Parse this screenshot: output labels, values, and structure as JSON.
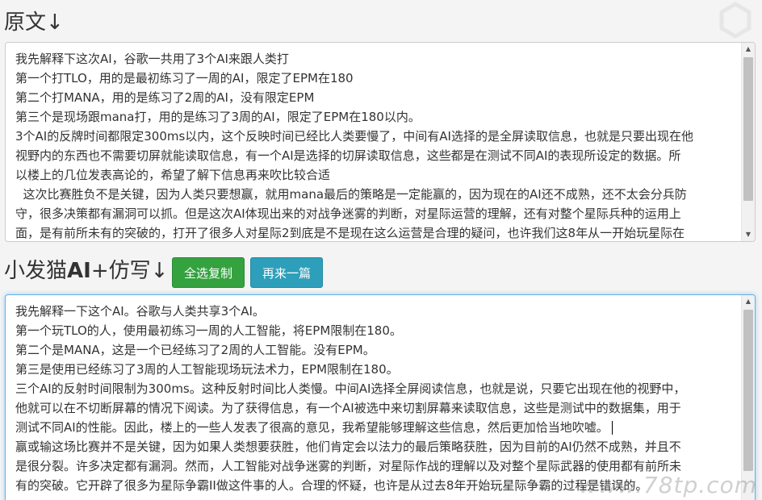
{
  "original": {
    "title": "原文↓",
    "lines": [
      "我先解释下这次AI，谷歌一共用了3个AI来跟人类打",
      "第一个打TLO，用的是最初练习了一周的AI，限定了EPM在180",
      "第二个打MANA，用的是练习了2周的AI，没有限定EPM",
      "第三个是现场跟mana打，用的是练习了3周的AI，限定了EPM在180以内。",
      "3个AI的反牌时间都限定300ms以内，这个反映时间已经比人类要慢了，中间有AI选择的是全屏读取信息，也就是只要出现在他",
      "视野内的东西也不需要切屏就能读取信息，有一个AI是选择的切屏读取信息，这些都是在测试不同AI的表现所设定的数据。所",
      "以楼上的几位发表高论的，希望了解下信息再来吹比较合适",
      "  这次比赛胜负不是关键，因为人类只要想赢，就用mana最后的策略是一定能赢的，因为现在的AI还不成熟，还不太会分兵防",
      "守，很多决策都有漏洞可以抓。但是这次AI体现出来的对战争迷雾的判断，对星际运营的理解，还有对整个星际兵种的运用上",
      "面，是有前所未有的突破的，打开了很多人对星际2到底是不是现在这么运营是合理的疑问，也许我们这8年从一开始玩星际在"
    ]
  },
  "rewrite": {
    "title_prefix": "小发猫",
    "title_ai": "AI",
    "title_suffix": "+仿写↓",
    "copy_button": "全选复制",
    "again_button": "再来一篇",
    "lines": [
      "我先解释一下这个AI。谷歌与人类共享3个AI。",
      "第一个玩TLO的人，使用最初练习一周的人工智能，将EPM限制在180。",
      "第二个是MANA，这是一个已经练习了2周的人工智能。没有EPM。",
      "第三是使用已经练习了3周的人工智能现场玩法术力，EPM限制在180。",
      "三个AI的反射时间限制为300ms。这种反射时间比人类慢。中间AI选择全屏阅读信息，也就是说，只要它出现在他的视野中，",
      "他就可以在不切断屏幕的情况下阅读。为了获得信息，有一个AI被选中来切割屏幕来读取信息，这些是测试中的数据集，用于",
      "测试不同AI的性能。因此，楼上的一些人发表了很高的意见，我希望能够理解这些信息，然后更加恰当地吹嘘。",
      "赢或输这场比赛并不是关键，因为如果人类想要获胜，他们肯定会以法力的最后策略获胜，因为目前的AI仍然不成熟，并且不",
      "是很分裂。许多决定都有漏洞。然而，人工智能对战争迷雾的判断，对星际作战的理解以及对整个星际武器的使用都有前所未",
      "有的突破。它开辟了很多为星际争霸II做这件事的人。合理的怀疑，也许是从过去8年开始玩星际争霸的过程是错误的。"
    ]
  },
  "watermark": "www.78tp.com"
}
